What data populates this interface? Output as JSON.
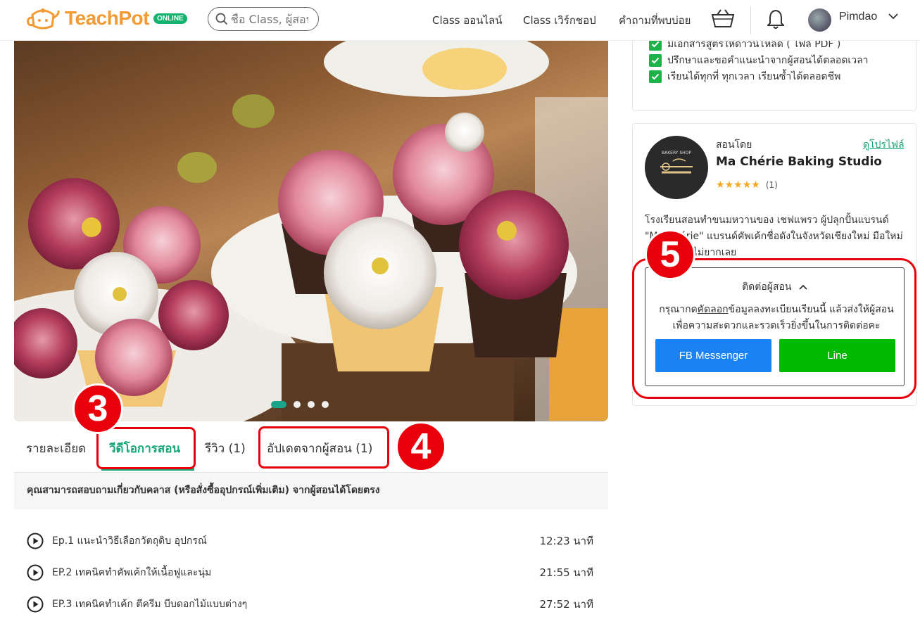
{
  "header": {
    "logo_text": "TeachPot",
    "logo_badge": "ONLINE",
    "search_placeholder": "ชื่อ Class, ผู้สอน",
    "nav": [
      "Class ออนไลน์",
      "Class เวิร์กชอป",
      "คำถามที่พบบ่อย"
    ],
    "username": "Pimdao"
  },
  "hero": {
    "slides": 4,
    "active_slide": 1
  },
  "tabs": [
    {
      "label": "รายละเอียด"
    },
    {
      "label": "วีดีโอการสอน",
      "active": true
    },
    {
      "label": "รีวิว (1)"
    },
    {
      "label": "อัปเดตจากผู้สอน (1)"
    }
  ],
  "notice": "คุณสามารถสอบถามเกี่ยวกับคลาส (หรือสั่งซื้ออุปกรณ์เพิ่มเติม) จากผู้สอนได้โดยตรง",
  "episodes": [
    {
      "title": "Ep.1 แนะนำวิธีเลือกวัตถุดิบ อุปกรณ์",
      "duration": "12:23 นาที"
    },
    {
      "title": "EP.2 เทคนิคทำคัพเค้กให้เนื้อฟูและนุ่ม",
      "duration": "21:55 นาที"
    },
    {
      "title": "EP.3 เทคนิคทำเค้ก ตีครีม บีบดอกไม้แบบต่างๆ",
      "duration": "27:52 นาที"
    }
  ],
  "benefits": [
    "มีเอกสารสูตรให้ดาวน์โหลด ( ไฟล์ PDF )",
    "ปรึกษาและขอคำแนะนำจากผู้สอนได้ตลอดเวลา",
    "เรียนได้ทุกที่ ทุกเวลา เรียนซ้ำได้ตลอดชีพ"
  ],
  "instructor": {
    "taught_by": "สอนโดย",
    "profile_link": "ดูโปรไฟล์",
    "name": "Ma Chérie Baking Studio",
    "rating_count": "(1)",
    "rating": 5,
    "logo_text": "BAKERY SHOP",
    "description": "โรงเรียนสอนทำขนมหวานของ เชฟแพรว ผู้ปลุกปั้นแบรนด์ \"Ma Chérie\" แบรนด์คัพเค้กชื่อดังในจังหวัดเชียงใหม่ มือใหม่ก็ทำตามได้ไม่ยากเลย"
  },
  "contact": {
    "title": "ติดต่อผู้สอน",
    "text_before": "กรุณากด",
    "text_link": "คัดลอก",
    "text_after": "ข้อมูลลงทะเบียนเรียนนี้ แล้วส่งให้ผู้สอน เพื่อความสะดวกและรวดเร็วยิ่งขึ้นในการติดต่อคะ",
    "fb_label": "FB Messenger",
    "line_label": "Line"
  },
  "annotations": [
    "3",
    "4",
    "5"
  ],
  "colors": {
    "brand_orange": "#f39a34",
    "brand_green": "#19a579",
    "annotation_red": "#e8000b",
    "fb_blue": "#1a82f2",
    "line_green": "#00b900"
  }
}
